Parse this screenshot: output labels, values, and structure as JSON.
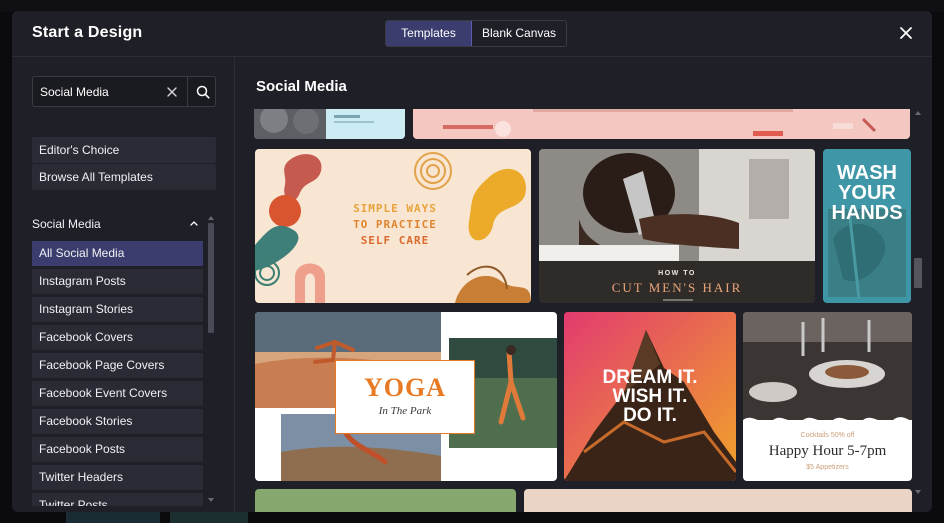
{
  "dialog": {
    "title": "Start a Design"
  },
  "tabs": [
    {
      "label": "Templates",
      "active": true
    },
    {
      "label": "Blank Canvas",
      "active": false
    }
  ],
  "search": {
    "value": "Social Media",
    "placeholder": ""
  },
  "quick_links": [
    "Editor's Choice",
    "Browse All Templates"
  ],
  "section": {
    "label": "Social Media",
    "expanded": true
  },
  "categories": [
    {
      "label": "All Social Media",
      "active": true
    },
    {
      "label": "Instagram Posts"
    },
    {
      "label": "Instagram Stories"
    },
    {
      "label": "Facebook Covers"
    },
    {
      "label": "Facebook Page Covers"
    },
    {
      "label": "Facebook Event Covers"
    },
    {
      "label": "Facebook Stories"
    },
    {
      "label": "Facebook Posts"
    },
    {
      "label": "Twitter Headers"
    },
    {
      "label": "Twitter Posts"
    }
  ],
  "content": {
    "title": "Social Media"
  },
  "templates": {
    "self_care": {
      "lines": [
        "SIMPLE WAYS",
        "TO PRACTICE",
        "SELF CARE"
      ]
    },
    "haircut": {
      "small": "HOW TO",
      "big": "CUT MEN'S HAIR"
    },
    "wash": {
      "lines": [
        "WASH",
        "YOUR",
        "HANDS"
      ]
    },
    "yoga": {
      "title": "YOGA",
      "subtitle": "In The Park"
    },
    "dream": {
      "lines": [
        "DREAM IT.",
        "WISH IT.",
        "DO IT."
      ]
    },
    "happy_hour": {
      "tag": "Cocktails 50% off",
      "title": "Happy Hour 5-7pm",
      "footer": "$5 Appetizers"
    }
  },
  "colors": {
    "accent": "#3b3d6e",
    "modal_bg": "#1f1f27",
    "item_bg": "#2b2b35",
    "self_care_orange": "#e8a33c",
    "haircut_text": "#e9a57a",
    "wash_bg": "#3f96a6",
    "yoga_orange": "#e77a22",
    "happy_hour_text": "#2b2b2b"
  }
}
